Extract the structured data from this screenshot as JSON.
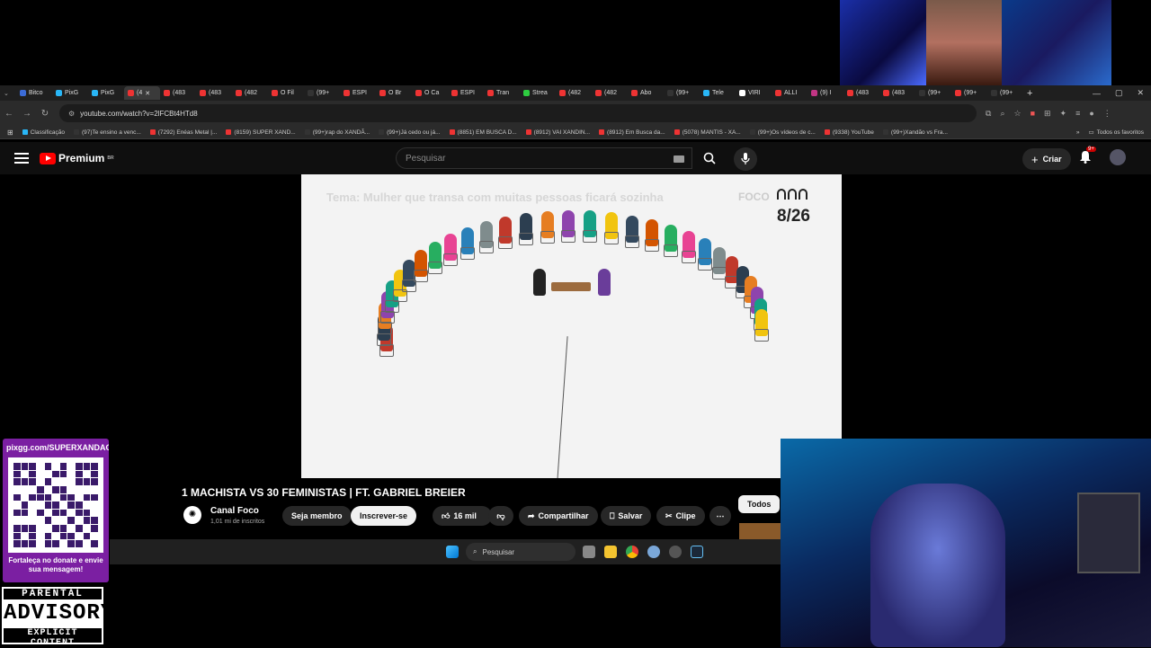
{
  "browser": {
    "tabs": [
      {
        "label": "Bitco",
        "color": "#3b6bd6"
      },
      {
        "label": "PixG",
        "color": "#29b6f6"
      },
      {
        "label": "PixG",
        "color": "#29b6f6"
      },
      {
        "label": "(4",
        "color": "#e33",
        "active": true
      },
      {
        "label": "(483",
        "color": "#e33"
      },
      {
        "label": "(483",
        "color": "#e33"
      },
      {
        "label": "(482",
        "color": "#e33"
      },
      {
        "label": "O Fil",
        "color": "#e33"
      },
      {
        "label": "(99+",
        "color": "#333"
      },
      {
        "label": "ESPI",
        "color": "#e33"
      },
      {
        "label": "O Br",
        "color": "#e33"
      },
      {
        "label": "O Ca",
        "color": "#e33"
      },
      {
        "label": "ESPI",
        "color": "#e33"
      },
      {
        "label": "Tran",
        "color": "#e33"
      },
      {
        "label": "Strea",
        "color": "#2ecc40"
      },
      {
        "label": "(482",
        "color": "#e33"
      },
      {
        "label": "(482",
        "color": "#e33"
      },
      {
        "label": "Abo",
        "color": "#e33"
      },
      {
        "label": "(99+",
        "color": "#333"
      },
      {
        "label": "Tele",
        "color": "#29b6f6"
      },
      {
        "label": "VIRI",
        "color": "#fff"
      },
      {
        "label": "ALLI",
        "color": "#e33"
      },
      {
        "label": "(9) I",
        "color": "#c13584"
      },
      {
        "label": "(483",
        "color": "#e33"
      },
      {
        "label": "(483",
        "color": "#e33"
      },
      {
        "label": "(99+",
        "color": "#333"
      },
      {
        "label": "(99+",
        "color": "#e33"
      },
      {
        "label": "(99+",
        "color": "#333"
      }
    ],
    "new_tab": "+",
    "url": "youtube.com/watch?v=2lFCBt4HTd8",
    "bookmarks": [
      {
        "label": "Classificação",
        "color": "#29b6f6"
      },
      {
        "label": "(97)Te ensino a venc...",
        "color": "#333"
      },
      {
        "label": "(7292) Enéas Metal |...",
        "color": "#e33"
      },
      {
        "label": "(8159) SUPER XAND...",
        "color": "#e33"
      },
      {
        "label": "(99+)rap do XANDÃ...",
        "color": "#333"
      },
      {
        "label": "(99+)Já cedo ou já...",
        "color": "#333"
      },
      {
        "label": "(8851) EM BUSCA D...",
        "color": "#e33"
      },
      {
        "label": "(8912) VAI XANDIN...",
        "color": "#e33"
      },
      {
        "label": "(8912) Em Busca da...",
        "color": "#e33"
      },
      {
        "label": "(5078) MANTIS - XA...",
        "color": "#e33"
      },
      {
        "label": "(99+)Os vídeos de c...",
        "color": "#333"
      },
      {
        "label": "(9338) YouTube",
        "color": "#e33"
      },
      {
        "label": "(99+)Xandão vs Fra...",
        "color": "#333"
      }
    ],
    "all_bookmarks": "Todos os favoritos"
  },
  "youtube": {
    "logo": "Premium",
    "region": "BR",
    "search_placeholder": "Pesquisar",
    "create_label": "Criar",
    "notif_count": "9+",
    "video": {
      "topic": "Tema: Mulher que transa com muitas pessoas ficará sozinha",
      "brand": "FOCO",
      "counter": "8/26"
    },
    "title": "1 MACHISTA VS 30 FEMINISTAS | FT. GABRIEL BREIER",
    "channel": {
      "name": "Canal Foco",
      "subs": "1,01 mi de inscritos"
    },
    "actions": {
      "join": "Seja membro",
      "subscribe": "Inscrever-se",
      "likes": "16 mil",
      "share": "Compartilhar",
      "save": "Salvar",
      "clip": "Clipe",
      "more": "⋯",
      "filter_all": "Todos"
    }
  },
  "taskbar": {
    "search": "Pesquisar"
  },
  "overlay": {
    "donate_url": "pixgg.com/SUPERXANDAO",
    "donate_msg": "Fortaleça no donate e envie sua mensagem!",
    "advisory_1": "PARENTAL",
    "advisory_2": "ADVISORY",
    "advisory_3": "EXPLICIT CONTENT"
  }
}
